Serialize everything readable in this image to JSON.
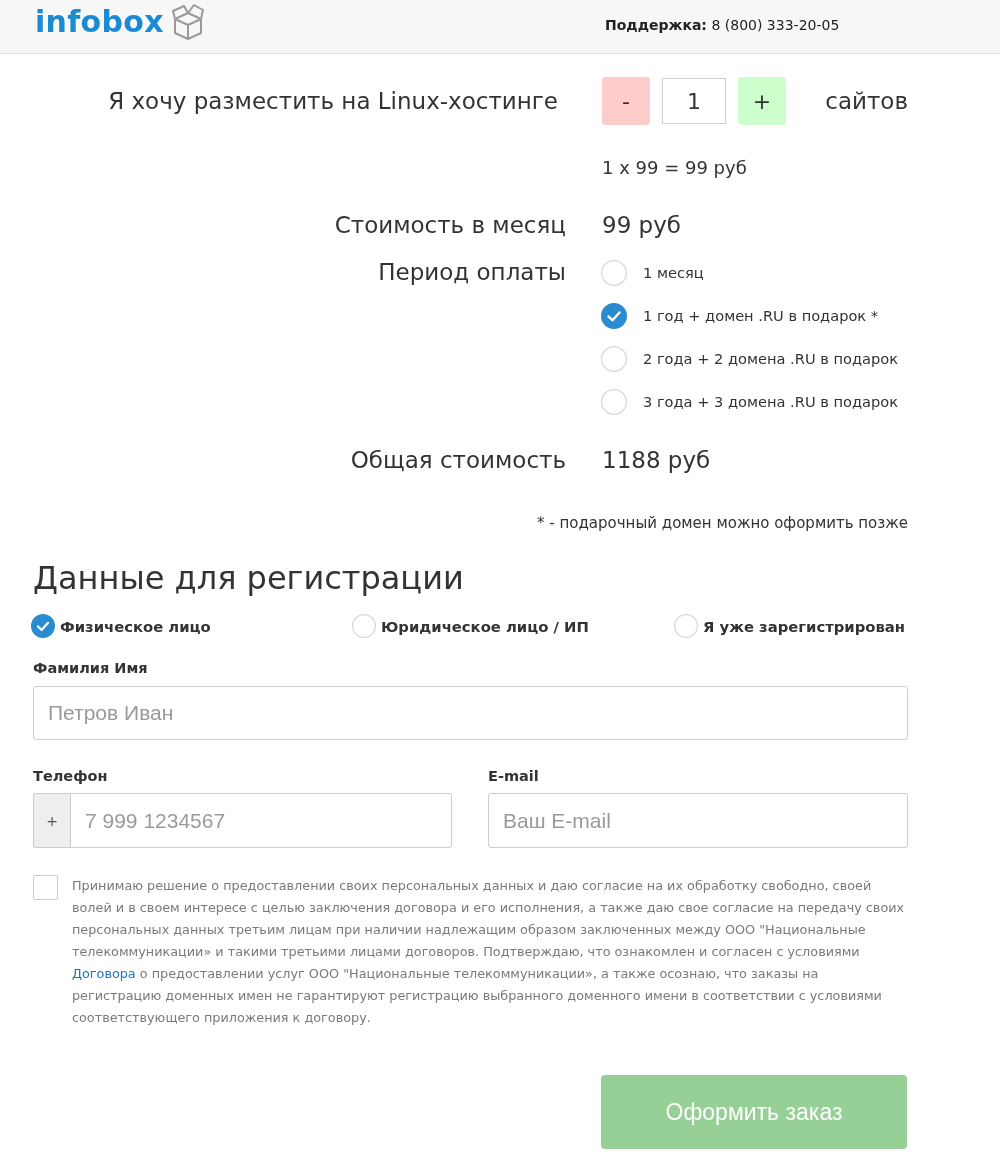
{
  "header": {
    "logo": "infobox",
    "support": "**Поддержка:** 8 (800) 333-20-05"
  },
  "order": {
    "intro": "Я хочу разместить на Linux-хостинге",
    "decrement": "-",
    "quantity": "1",
    "increment": "+",
    "unit": "сайтов",
    "calculation": "1 x 99 = 99 руб",
    "monthly_label": "Стоимость в месяц",
    "monthly_value": "99 руб",
    "period_label": "Период оплаты",
    "periods": [
      {
        "label": "1 месяц",
        "selected": false
      },
      {
        "label": "1 год + домен .RU в подарок *",
        "selected": true
      },
      {
        "label": "2 года + 2 домена .RU в подарок",
        "selected": false
      },
      {
        "label": "3 года + 3 домена .RU в подарок",
        "selected": false
      }
    ],
    "total_label": "Общая стоимость",
    "total_value": "1188 руб",
    "note": "* - подарочный домен можно оформить позже"
  },
  "registration": {
    "title": "Данные для регистрации",
    "types": [
      {
        "label": "Физическое лицо",
        "selected": true
      },
      {
        "label": "Юридическое лицо / ИП",
        "selected": false
      },
      {
        "label": "Я уже зарегистрирован",
        "selected": false
      }
    ],
    "name": {
      "label": "Фамилия Имя",
      "placeholder": "Петров Иван"
    },
    "phone": {
      "label": "Телефон",
      "prefix": "+",
      "placeholder": "7 999 1234567"
    },
    "email": {
      "label": "E-mail",
      "placeholder": "Ваш E-mail"
    },
    "consent": {
      "checked": false,
      "text_before": "Принимаю решение о предоставлении своих персональных данных и даю согласие на их обработку свободно, своей волей и в своем интересе с целью заключения договора и его исполнения, а также даю свое согласие на передачу своих персональных данных третьим лицам при наличии надлежащим образом заключенных между ООО \"Национальные телекоммуникации» и такими третьими лицами договоров. Подтверждаю, что ознакомлен и согласен с условиями",
      "link": "Договора",
      "text_after": "о предоставлении услуг ООО \"Национальные телекоммуникации», а также осознаю, что заказы на регистрацию доменных имен не гарантируют регистрацию выбранного доменного имени в соответствии с условиями соответствующего приложения к договору."
    },
    "submit": "Оформить заказ"
  }
}
